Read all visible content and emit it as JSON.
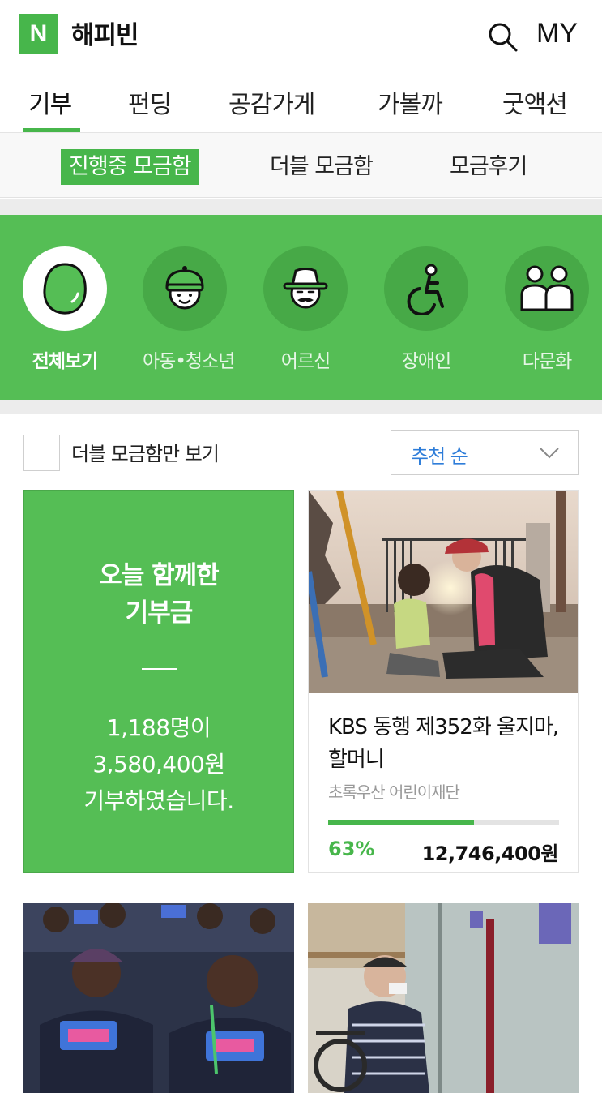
{
  "header": {
    "logo_letter": "N",
    "app_title": "해피빈",
    "my_label": "MY",
    "brand_color": "#47b64b"
  },
  "main_tabs": [
    {
      "label": "기부",
      "active": true
    },
    {
      "label": "펀딩",
      "active": false
    },
    {
      "label": "공감가게",
      "active": false
    },
    {
      "label": "가볼까",
      "active": false
    },
    {
      "label": "굿액션",
      "active": false
    }
  ],
  "sub_tabs": [
    {
      "label": "진행중 모금함",
      "active": true
    },
    {
      "label": "더블 모금함",
      "active": false
    },
    {
      "label": "모금후기",
      "active": false
    }
  ],
  "categories": [
    {
      "label": "전체보기",
      "icon": "bean-icon",
      "active": true
    },
    {
      "label": "아동•청소년",
      "icon": "child-icon",
      "active": false
    },
    {
      "label": "어르신",
      "icon": "elder-icon",
      "active": false
    },
    {
      "label": "장애인",
      "icon": "wheelchair-icon",
      "active": false
    },
    {
      "label": "다문화",
      "icon": "people-icon",
      "active": false
    }
  ],
  "filter": {
    "checkbox_label": "더블 모금함만 보기",
    "checked": false,
    "sort_label": "추천 순"
  },
  "summary": {
    "heading_line1": "오늘 함께한",
    "heading_line2": "기부금",
    "divider": "—",
    "people_count": "1,188명이",
    "amount": "3,580,400원",
    "closing": "기부하였습니다."
  },
  "project": {
    "title": "KBS 동행 제352화 울지마, 할머니",
    "organization": "초록우산 어린이재단",
    "progress_percent": 63,
    "progress_label": "63%",
    "raised_amount": "12,746,400원"
  }
}
